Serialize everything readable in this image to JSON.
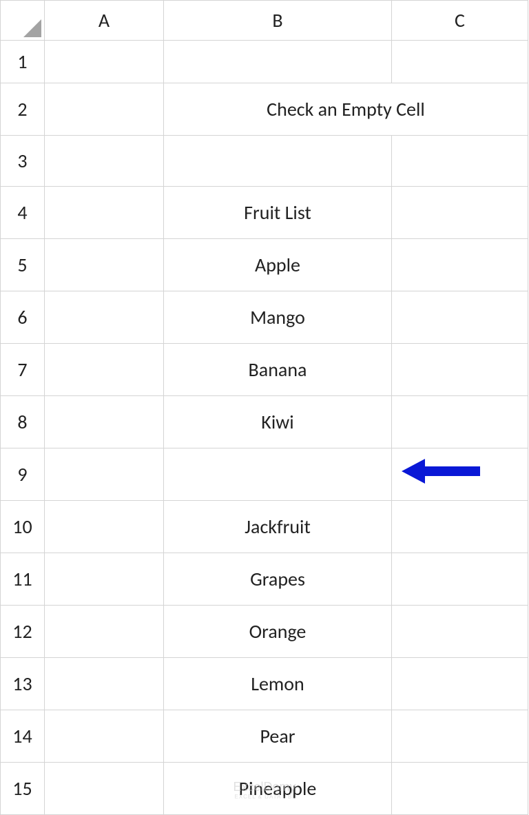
{
  "columns": {
    "A": "A",
    "B": "B",
    "C": "C"
  },
  "rows": [
    "1",
    "2",
    "3",
    "4",
    "5",
    "6",
    "7",
    "8",
    "9",
    "10",
    "11",
    "12",
    "13",
    "14",
    "15"
  ],
  "title": "Check an Empty Cell",
  "table": {
    "header": "Fruit List",
    "items": [
      "Apple",
      "Mango",
      "Banana",
      "Kiwi",
      "",
      "Jackfruit",
      "Grapes",
      "Orange",
      "Lemon",
      "Pear",
      "Pineapple"
    ]
  },
  "chart_data": {
    "type": "table",
    "title": "Fruit List",
    "categories": [
      "B5",
      "B6",
      "B7",
      "B8",
      "B9",
      "B10",
      "B11",
      "B12",
      "B13",
      "B14",
      "B15"
    ],
    "values": [
      "Apple",
      "Mango",
      "Banana",
      "Kiwi",
      "",
      "Jackfruit",
      "Grapes",
      "Orange",
      "Lemon",
      "Pear",
      "Pineapple"
    ],
    "annotations": [
      "empty cell at B9 highlighted by arrow"
    ]
  },
  "watermark": {
    "brand": "ExcelDemy",
    "tag": "EXCEL & DATA · BI"
  }
}
